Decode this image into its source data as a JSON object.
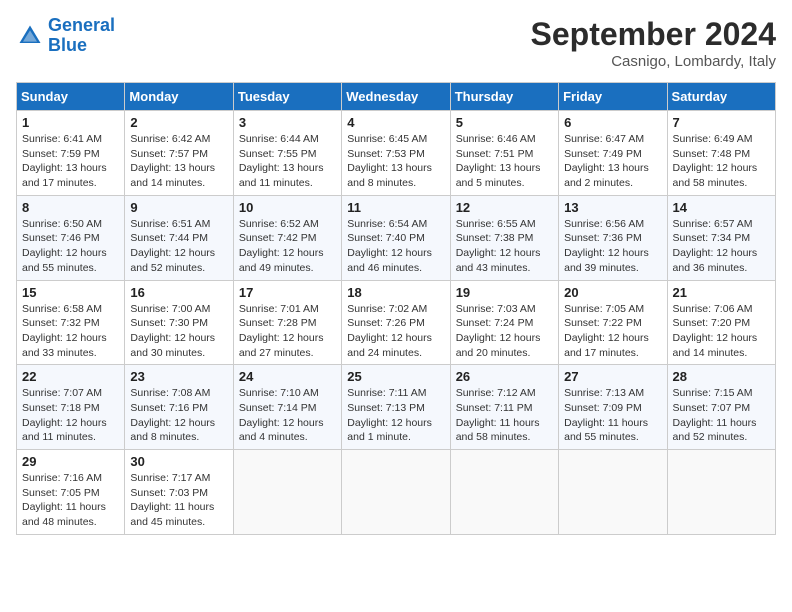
{
  "header": {
    "logo_line1": "General",
    "logo_line2": "Blue",
    "month_title": "September 2024",
    "location": "Casnigo, Lombardy, Italy"
  },
  "weekdays": [
    "Sunday",
    "Monday",
    "Tuesday",
    "Wednesday",
    "Thursday",
    "Friday",
    "Saturday"
  ],
  "weeks": [
    [
      {
        "day": "1",
        "sunrise": "6:41 AM",
        "sunset": "7:59 PM",
        "daylight": "13 hours and 17 minutes."
      },
      {
        "day": "2",
        "sunrise": "6:42 AM",
        "sunset": "7:57 PM",
        "daylight": "13 hours and 14 minutes."
      },
      {
        "day": "3",
        "sunrise": "6:44 AM",
        "sunset": "7:55 PM",
        "daylight": "13 hours and 11 minutes."
      },
      {
        "day": "4",
        "sunrise": "6:45 AM",
        "sunset": "7:53 PM",
        "daylight": "13 hours and 8 minutes."
      },
      {
        "day": "5",
        "sunrise": "6:46 AM",
        "sunset": "7:51 PM",
        "daylight": "13 hours and 5 minutes."
      },
      {
        "day": "6",
        "sunrise": "6:47 AM",
        "sunset": "7:49 PM",
        "daylight": "13 hours and 2 minutes."
      },
      {
        "day": "7",
        "sunrise": "6:49 AM",
        "sunset": "7:48 PM",
        "daylight": "12 hours and 58 minutes."
      }
    ],
    [
      {
        "day": "8",
        "sunrise": "6:50 AM",
        "sunset": "7:46 PM",
        "daylight": "12 hours and 55 minutes."
      },
      {
        "day": "9",
        "sunrise": "6:51 AM",
        "sunset": "7:44 PM",
        "daylight": "12 hours and 52 minutes."
      },
      {
        "day": "10",
        "sunrise": "6:52 AM",
        "sunset": "7:42 PM",
        "daylight": "12 hours and 49 minutes."
      },
      {
        "day": "11",
        "sunrise": "6:54 AM",
        "sunset": "7:40 PM",
        "daylight": "12 hours and 46 minutes."
      },
      {
        "day": "12",
        "sunrise": "6:55 AM",
        "sunset": "7:38 PM",
        "daylight": "12 hours and 43 minutes."
      },
      {
        "day": "13",
        "sunrise": "6:56 AM",
        "sunset": "7:36 PM",
        "daylight": "12 hours and 39 minutes."
      },
      {
        "day": "14",
        "sunrise": "6:57 AM",
        "sunset": "7:34 PM",
        "daylight": "12 hours and 36 minutes."
      }
    ],
    [
      {
        "day": "15",
        "sunrise": "6:58 AM",
        "sunset": "7:32 PM",
        "daylight": "12 hours and 33 minutes."
      },
      {
        "day": "16",
        "sunrise": "7:00 AM",
        "sunset": "7:30 PM",
        "daylight": "12 hours and 30 minutes."
      },
      {
        "day": "17",
        "sunrise": "7:01 AM",
        "sunset": "7:28 PM",
        "daylight": "12 hours and 27 minutes."
      },
      {
        "day": "18",
        "sunrise": "7:02 AM",
        "sunset": "7:26 PM",
        "daylight": "12 hours and 24 minutes."
      },
      {
        "day": "19",
        "sunrise": "7:03 AM",
        "sunset": "7:24 PM",
        "daylight": "12 hours and 20 minutes."
      },
      {
        "day": "20",
        "sunrise": "7:05 AM",
        "sunset": "7:22 PM",
        "daylight": "12 hours and 17 minutes."
      },
      {
        "day": "21",
        "sunrise": "7:06 AM",
        "sunset": "7:20 PM",
        "daylight": "12 hours and 14 minutes."
      }
    ],
    [
      {
        "day": "22",
        "sunrise": "7:07 AM",
        "sunset": "7:18 PM",
        "daylight": "12 hours and 11 minutes."
      },
      {
        "day": "23",
        "sunrise": "7:08 AM",
        "sunset": "7:16 PM",
        "daylight": "12 hours and 8 minutes."
      },
      {
        "day": "24",
        "sunrise": "7:10 AM",
        "sunset": "7:14 PM",
        "daylight": "12 hours and 4 minutes."
      },
      {
        "day": "25",
        "sunrise": "7:11 AM",
        "sunset": "7:13 PM",
        "daylight": "12 hours and 1 minute."
      },
      {
        "day": "26",
        "sunrise": "7:12 AM",
        "sunset": "7:11 PM",
        "daylight": "11 hours and 58 minutes."
      },
      {
        "day": "27",
        "sunrise": "7:13 AM",
        "sunset": "7:09 PM",
        "daylight": "11 hours and 55 minutes."
      },
      {
        "day": "28",
        "sunrise": "7:15 AM",
        "sunset": "7:07 PM",
        "daylight": "11 hours and 52 minutes."
      }
    ],
    [
      {
        "day": "29",
        "sunrise": "7:16 AM",
        "sunset": "7:05 PM",
        "daylight": "11 hours and 48 minutes."
      },
      {
        "day": "30",
        "sunrise": "7:17 AM",
        "sunset": "7:03 PM",
        "daylight": "11 hours and 45 minutes."
      },
      null,
      null,
      null,
      null,
      null
    ]
  ],
  "labels": {
    "sunrise": "Sunrise:",
    "sunset": "Sunset:",
    "daylight": "Daylight:"
  }
}
